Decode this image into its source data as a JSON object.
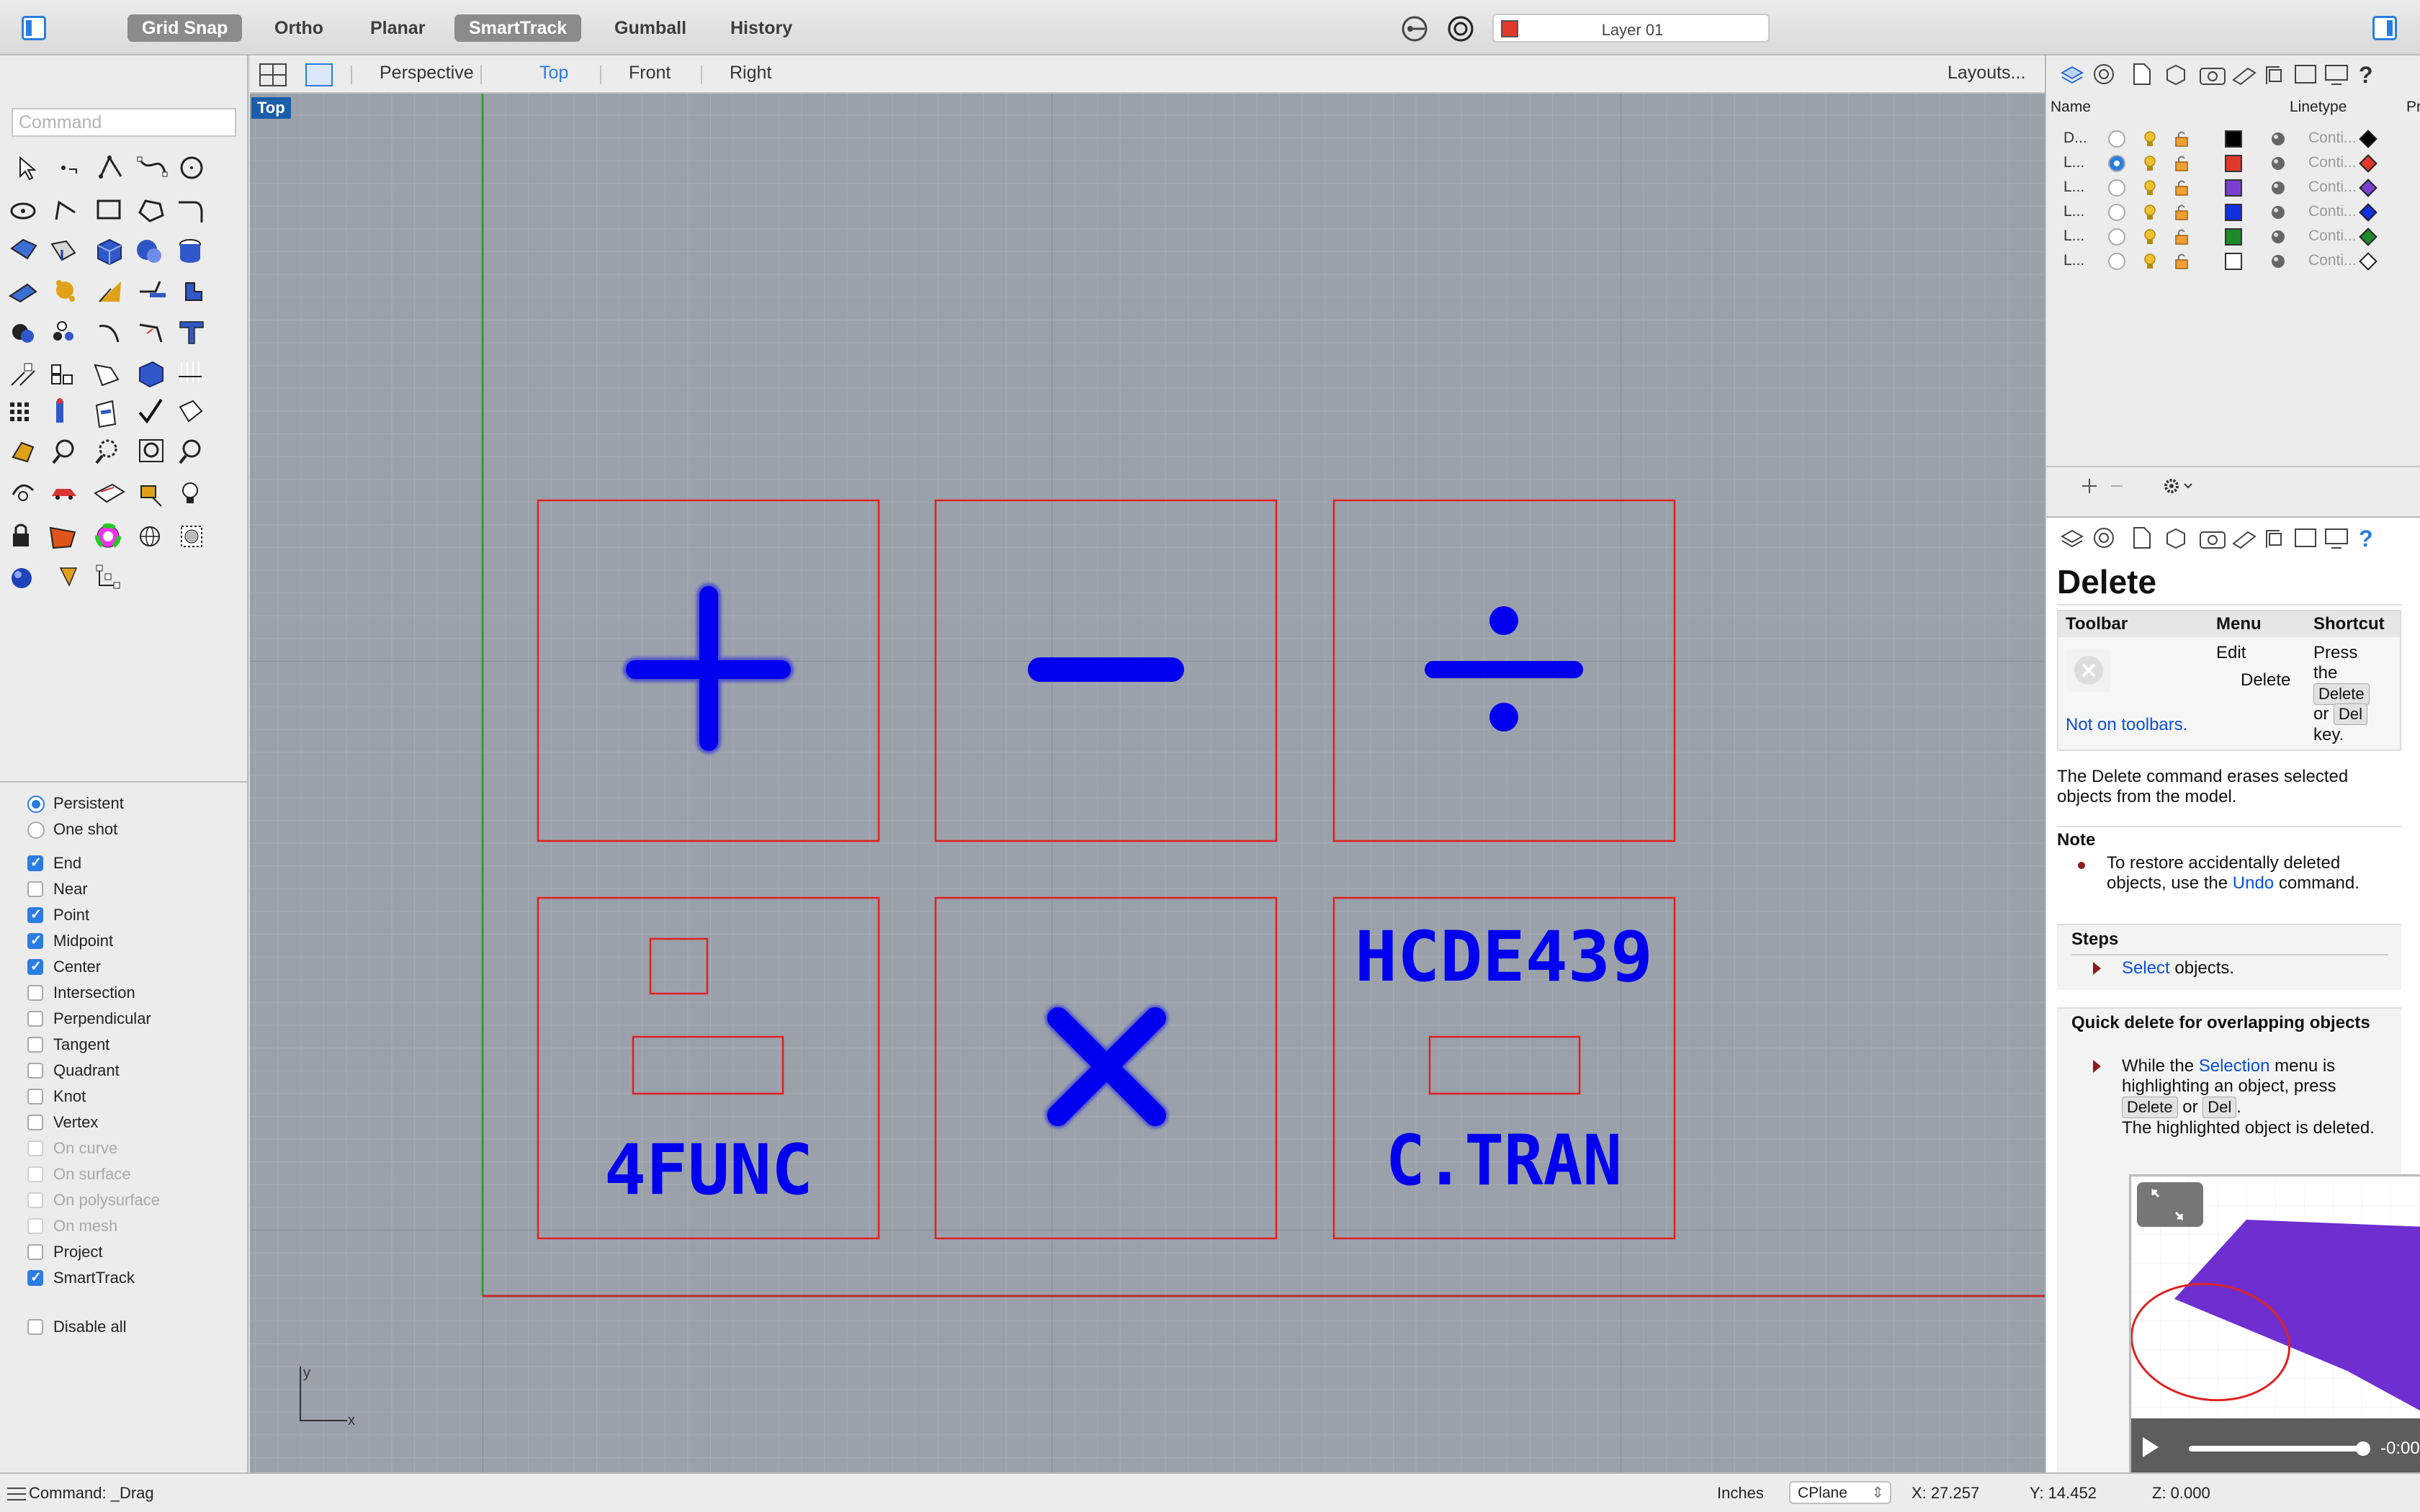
{
  "toolbar": {
    "modes": [
      {
        "label": "Grid Snap",
        "active": true
      },
      {
        "label": "Ortho",
        "active": false
      },
      {
        "label": "Planar",
        "active": false
      },
      {
        "label": "SmartTrack",
        "active": true
      },
      {
        "label": "Gumball",
        "active": false
      },
      {
        "label": "History",
        "active": false
      }
    ],
    "current_layer": "Layer 01",
    "current_layer_color": "#e0392b"
  },
  "command": {
    "placeholder": "Command",
    "prompt": "Command: _Drag"
  },
  "viewport_tabs": {
    "tabs": [
      "Perspective",
      "Top",
      "Front",
      "Right"
    ],
    "active": "Top",
    "layouts_label": "Layouts..."
  },
  "viewport": {
    "label": "Top",
    "axis_x": "x",
    "axis_y": "y",
    "texts": {
      "four_func": "4FUNC",
      "course": "HCDE439",
      "author": "C.TRAN"
    },
    "stroke_color": "#0000ee",
    "frame_color": "#e02020"
  },
  "osnap": {
    "mode": [
      {
        "label": "Persistent",
        "on": true
      },
      {
        "label": "One shot",
        "on": false
      }
    ],
    "snaps": [
      {
        "label": "End",
        "on": true,
        "enabled": true
      },
      {
        "label": "Near",
        "on": false,
        "enabled": true
      },
      {
        "label": "Point",
        "on": true,
        "enabled": true
      },
      {
        "label": "Midpoint",
        "on": true,
        "enabled": true
      },
      {
        "label": "Center",
        "on": true,
        "enabled": true
      },
      {
        "label": "Intersection",
        "on": false,
        "enabled": true
      },
      {
        "label": "Perpendicular",
        "on": false,
        "enabled": true
      },
      {
        "label": "Tangent",
        "on": false,
        "enabled": true
      },
      {
        "label": "Quadrant",
        "on": false,
        "enabled": true
      },
      {
        "label": "Knot",
        "on": false,
        "enabled": true
      },
      {
        "label": "Vertex",
        "on": false,
        "enabled": true
      },
      {
        "label": "On curve",
        "on": false,
        "enabled": false
      },
      {
        "label": "On surface",
        "on": false,
        "enabled": false
      },
      {
        "label": "On polysurface",
        "on": false,
        "enabled": false
      },
      {
        "label": "On mesh",
        "on": false,
        "enabled": false
      },
      {
        "label": "Project",
        "on": false,
        "enabled": true
      },
      {
        "label": "SmartTrack",
        "on": true,
        "enabled": true
      }
    ],
    "disable_all": "Disable all"
  },
  "layers": {
    "headers": {
      "name": "Name",
      "linetype": "Linetype",
      "print": "Pr"
    },
    "rows": [
      {
        "name": "D...",
        "color": "#000000",
        "linetype": "Conti...",
        "current": false
      },
      {
        "name": "L...",
        "color": "#e0392b",
        "linetype": "Conti...",
        "current": true
      },
      {
        "name": "L...",
        "color": "#7b3fd0",
        "linetype": "Conti...",
        "current": false
      },
      {
        "name": "L...",
        "color": "#1030e0",
        "linetype": "Conti...",
        "current": false
      },
      {
        "name": "L...",
        "color": "#1f8a2a",
        "linetype": "Conti...",
        "current": false
      },
      {
        "name": "L...",
        "color": "#ffffff",
        "linetype": "Conti...",
        "current": false
      }
    ]
  },
  "help": {
    "title": "Delete",
    "col_toolbar": "Toolbar",
    "col_menu": "Menu",
    "col_shortcut": "Shortcut",
    "not_on_toolbars": "Not on toolbars.",
    "menu_edit": "Edit",
    "menu_delete": "Delete",
    "shortcut_press": "Press",
    "shortcut_the": "the",
    "key_delete": "Delete",
    "shortcut_or": "or",
    "key_del": "Del",
    "shortcut_key": "key.",
    "description": "The Delete command erases selected objects from the model.",
    "note_heading": "Note",
    "note_text_1": "To restore accidentally deleted",
    "note_text_2": "objects, use the",
    "note_link": "Undo",
    "note_text_3": "command.",
    "steps_heading": "Steps",
    "steps_link": "Select",
    "steps_text": "objects.",
    "quick_heading": "Quick delete for overlapping objects",
    "quick_text_1": "While the",
    "quick_link": "Selection",
    "quick_text_2": "menu is highlighting an object, press",
    "quick_or": "or",
    "quick_text_3": "The highlighted object is deleted.",
    "video_time": "-0:00"
  },
  "status": {
    "units": "Inches",
    "cplane": "CPlane",
    "x": "X: 27.257",
    "y": "Y: 14.452",
    "z": "Z: 0.000"
  }
}
